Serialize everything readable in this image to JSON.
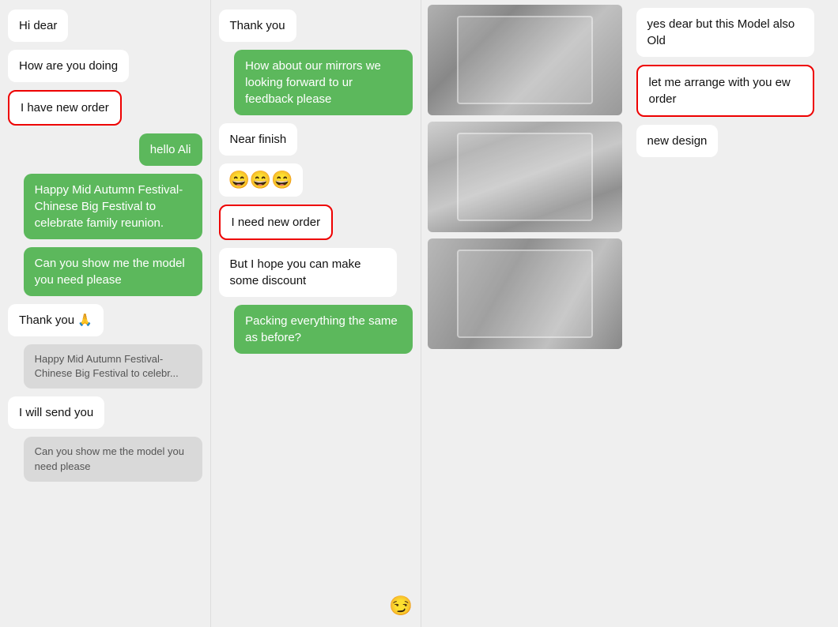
{
  "col1": {
    "messages": [
      {
        "id": "hi-dear",
        "text": "Hi dear",
        "type": "left",
        "highlight": false
      },
      {
        "id": "how-are-you",
        "text": "How are you doing",
        "type": "left",
        "highlight": false
      },
      {
        "id": "have-new-order",
        "text": "I have new order",
        "type": "left",
        "highlight": true
      },
      {
        "id": "hello-ali",
        "text": "hello Ali",
        "type": "right",
        "highlight": false
      },
      {
        "id": "happy-festival",
        "text": "Happy Mid Autumn Festival- Chinese Big Festival to celebrate family reunion.",
        "type": "green",
        "highlight": false
      },
      {
        "id": "show-model",
        "text": "Can you show me the model you need please",
        "type": "green",
        "highlight": false
      },
      {
        "id": "thank-you-pray",
        "text": "Thank you 🙏",
        "type": "left",
        "highlight": false
      },
      {
        "id": "happy-festival-gray",
        "text": "Happy Mid Autumn Festival- Chinese Big Festival to celebr...",
        "type": "gray",
        "highlight": false
      },
      {
        "id": "will-send-you",
        "text": "I will send you",
        "type": "left",
        "highlight": false
      },
      {
        "id": "show-model-gray",
        "text": "Can you show me the model you need please",
        "type": "gray",
        "highlight": false
      }
    ]
  },
  "col2": {
    "messages": [
      {
        "id": "thank-you",
        "text": "Thank you",
        "type": "left",
        "highlight": false
      },
      {
        "id": "mirrors-feedback",
        "text": "How about our mirrors we looking forward to ur feedback please",
        "type": "green",
        "highlight": false
      },
      {
        "id": "near-finish",
        "text": "Near finish",
        "type": "left",
        "highlight": false
      },
      {
        "id": "emoji-laughing",
        "text": "😄😄😄",
        "type": "emoji",
        "highlight": false
      },
      {
        "id": "need-new-order",
        "text": "I need new order",
        "type": "left",
        "highlight": true
      },
      {
        "id": "hope-discount",
        "text": "But I hope you can make some discount",
        "type": "left",
        "highlight": false
      },
      {
        "id": "packing-same",
        "text": "Packing everything the same as before?",
        "type": "green",
        "highlight": false
      }
    ],
    "icon": "😏"
  },
  "col3_images": [
    {
      "id": "mirror-img-1",
      "label": "mirror image 1"
    },
    {
      "id": "mirror-img-2",
      "label": "mirror image 2"
    },
    {
      "id": "mirror-img-3",
      "label": "mirror image 3"
    }
  ],
  "col4": {
    "messages": [
      {
        "id": "yes-dear-old",
        "text": "yes dear but this Model also Old",
        "type": "left",
        "highlight": false
      },
      {
        "id": "arrange-new-order",
        "text": "let me arrange with you ew order",
        "type": "left",
        "highlight": true
      },
      {
        "id": "new-design",
        "text": "new design",
        "type": "left",
        "highlight": false
      }
    ]
  }
}
